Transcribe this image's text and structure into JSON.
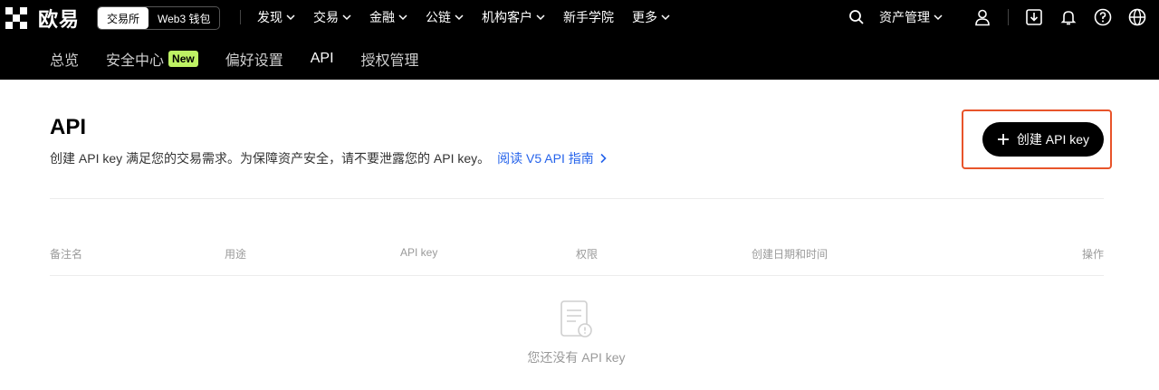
{
  "brand": {
    "name": "欧易"
  },
  "mode_toggle": {
    "active": "交易所",
    "inactive": "Web3 钱包"
  },
  "nav": [
    {
      "label": "发现",
      "dropdown": true
    },
    {
      "label": "交易",
      "dropdown": true
    },
    {
      "label": "金融",
      "dropdown": true
    },
    {
      "label": "公链",
      "dropdown": true
    },
    {
      "label": "机构客户",
      "dropdown": true
    },
    {
      "label": "新手学院",
      "dropdown": false
    },
    {
      "label": "更多",
      "dropdown": true
    }
  ],
  "tools": {
    "asset_management": "资产管理"
  },
  "subnav": {
    "overview": "总览",
    "security": "安全中心",
    "security_badge": "New",
    "preferences": "偏好设置",
    "api": "API",
    "authorization": "授权管理"
  },
  "page": {
    "title": "API",
    "description": "创建 API key 满足您的交易需求。为保障资产安全，请不要泄露您的 API key。",
    "guide_link": "阅读 V5 API 指南",
    "create_button": "创建 API key"
  },
  "table": {
    "columns": [
      "备注名",
      "用途",
      "API key",
      "权限",
      "创建日期和时间",
      "操作"
    ],
    "empty_text": "您还没有 API key"
  },
  "colors": {
    "accent_badge": "#bef264",
    "link": "#2563eb",
    "highlight": "#e8542a"
  }
}
